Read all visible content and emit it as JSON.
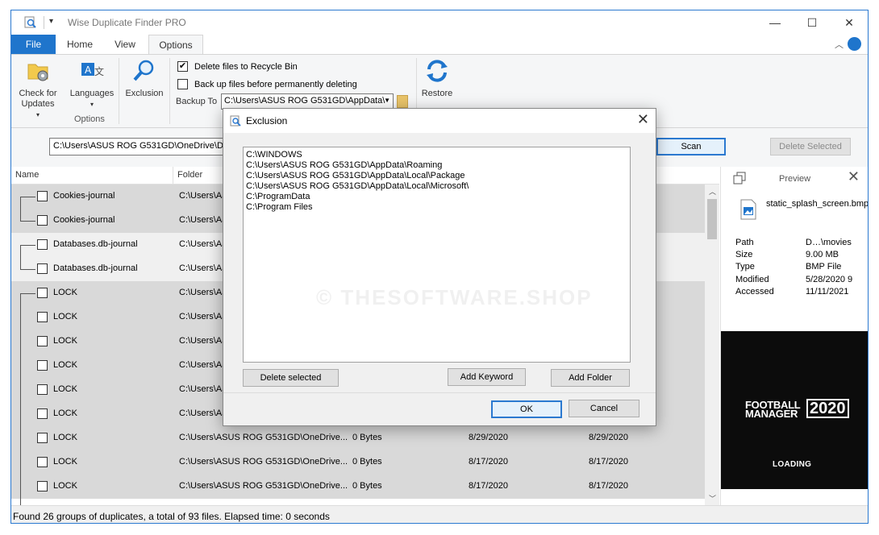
{
  "window": {
    "title": "Wise Duplicate Finder PRO"
  },
  "tabs": [
    {
      "label": "File"
    },
    {
      "label": "Home"
    },
    {
      "label": "View"
    },
    {
      "label": "Options"
    }
  ],
  "ribbon": {
    "check_updates": "Check for\nUpdates",
    "languages": "Languages",
    "exclusion": "Exclusion",
    "group_label": "Options",
    "delete_recycle": "Delete files to Recycle Bin",
    "backup_before": "Back up files before permanently deleting",
    "backup_to_label": "Backup To",
    "backup_path": "C:\\Users\\ASUS ROG G531GD\\AppData\\",
    "restore": "Restore"
  },
  "search": {
    "path": "C:\\Users\\ASUS ROG G531GD\\OneDrive\\Dokumen",
    "scan": "Scan",
    "delete_selected": "Delete Selected"
  },
  "list": {
    "headers": {
      "name": "Name",
      "folder": "Folder"
    },
    "rows": [
      {
        "name": "Cookies-journal",
        "folder": "C:\\Users\\AS",
        "size": "",
        "d1": "",
        "d2": ""
      },
      {
        "name": "Cookies-journal",
        "folder": "C:\\Users\\AS",
        "size": "",
        "d1": "",
        "d2": ""
      },
      {
        "name": "Databases.db-journal",
        "folder": "C:\\Users\\AS",
        "size": "",
        "d1": "",
        "d2": ""
      },
      {
        "name": "Databases.db-journal",
        "folder": "C:\\Users\\AS",
        "size": "",
        "d1": "",
        "d2": ""
      },
      {
        "name": "LOCK",
        "folder": "C:\\Users\\AS",
        "size": "",
        "d1": "",
        "d2": ""
      },
      {
        "name": "LOCK",
        "folder": "C:\\Users\\AS",
        "size": "",
        "d1": "",
        "d2": ""
      },
      {
        "name": "LOCK",
        "folder": "C:\\Users\\AS",
        "size": "",
        "d1": "",
        "d2": ""
      },
      {
        "name": "LOCK",
        "folder": "C:\\Users\\AS",
        "size": "",
        "d1": "",
        "d2": ""
      },
      {
        "name": "LOCK",
        "folder": "C:\\Users\\AS",
        "size": "",
        "d1": "",
        "d2": ""
      },
      {
        "name": "LOCK",
        "folder": "C:\\Users\\AS",
        "size": "",
        "d1": "",
        "d2": ""
      },
      {
        "name": "LOCK",
        "folder": "C:\\Users\\ASUS ROG G531GD\\OneDrive...",
        "size": "0 Bytes",
        "d1": "8/29/2020",
        "d2": "8/29/2020"
      },
      {
        "name": "LOCK",
        "folder": "C:\\Users\\ASUS ROG G531GD\\OneDrive...",
        "size": "0 Bytes",
        "d1": "8/17/2020",
        "d2": "8/17/2020"
      },
      {
        "name": "LOCK",
        "folder": "C:\\Users\\ASUS ROG G531GD\\OneDrive...",
        "size": "0 Bytes",
        "d1": "8/17/2020",
        "d2": "8/17/2020"
      }
    ]
  },
  "preview": {
    "title": "Preview",
    "file_name": "static_splash_screen.bmp",
    "fields": [
      {
        "key": "Path",
        "value": "D…\\movies"
      },
      {
        "key": "Size",
        "value": "9.00 MB"
      },
      {
        "key": "Type",
        "value": "BMP File"
      },
      {
        "key": "Modified",
        "value": "5/28/2020 9"
      },
      {
        "key": "Accessed",
        "value": "11/11/2021"
      }
    ],
    "image_title": "FOOTBALL\nMANAGER",
    "image_year": "2020",
    "image_loading": "LOADING"
  },
  "status": "Found 26 groups of duplicates, a total of 93 files. Elapsed time: 0 seconds",
  "dialog": {
    "title": "Exclusion",
    "items": [
      "C:\\WINDOWS",
      "C:\\Users\\ASUS ROG G531GD\\AppData\\Roaming",
      "C:\\Users\\ASUS ROG G531GD\\AppData\\Local\\Package",
      "C:\\Users\\ASUS ROG G531GD\\AppData\\Local\\Microsoft\\",
      "C:\\ProgramData",
      "C:\\Program Files"
    ],
    "delete_selected": "Delete selected",
    "add_keyword": "Add Keyword",
    "add_folder": "Add Folder",
    "ok": "OK",
    "cancel": "Cancel",
    "watermark": "© THESOFTWARE.SHOP"
  },
  "colors": {
    "accent": "#1f75cc",
    "group_gray": "#d9d9d9"
  }
}
